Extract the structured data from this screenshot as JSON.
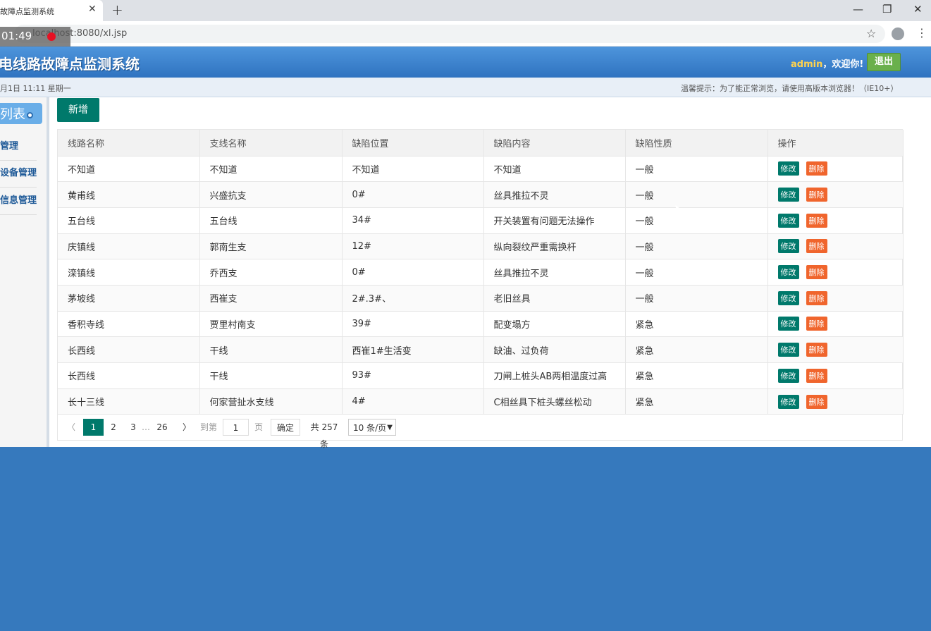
{
  "browser": {
    "tab_title": "故障点监测系统",
    "tab_close": "✕",
    "new_tab": "+",
    "url": "localhost:8080/xl.jsp",
    "url_prefix": "|loc",
    "overlay_time": "01:49",
    "minimize": "—",
    "restore": "❐",
    "close": "✕",
    "star": "☆",
    "menu": "⋮"
  },
  "header": {
    "title": "配电线路故障点监测系统",
    "user": "admin",
    "welcome": "，欢迎你!",
    "logout": "退出"
  },
  "info": {
    "date": "月1日 11:11 星期一",
    "tip": "温馨提示：为了能正常浏览，请使用高版本浏览器！（IE10+）"
  },
  "sidebar": {
    "heading": "列表",
    "items": [
      {
        "label": "管理"
      },
      {
        "label": "设备管理"
      },
      {
        "label": "信息管理"
      }
    ]
  },
  "toolbar": {
    "add_label": "新增"
  },
  "table": {
    "columns": [
      "线路名称",
      "支线名称",
      "缺陷位置",
      "缺陷内容",
      "缺陷性质",
      "操作"
    ],
    "edit_label": "修改",
    "delete_label": "删除",
    "rows": [
      [
        "不知道",
        "不知道",
        "不知道",
        "不知道",
        "一般"
      ],
      [
        "黄甫线",
        "兴盛抗支",
        "0#",
        "丝具推拉不灵",
        "一般"
      ],
      [
        "五台线",
        "五台线",
        "34#",
        "开关装置有问题无法操作",
        "一般"
      ],
      [
        "庆镇线",
        "郭南生支",
        "12#",
        "纵向裂纹严重需换杆",
        "一般"
      ],
      [
        "滦镇线",
        "乔西支",
        "0#",
        "丝具推拉不灵",
        "一般"
      ],
      [
        "茅坡线",
        "西崔支",
        "2#.3#、",
        "老旧丝具",
        "一般"
      ],
      [
        "香积寺线",
        "贾里村南支",
        "39#",
        "配变塌方",
        "紧急"
      ],
      [
        "长西线",
        "干线",
        "西崔1#生活变",
        "缺油、过负荷",
        "紧急"
      ],
      [
        "长西线",
        "干线",
        "93#",
        "刀闸上桩头AB两相温度过高",
        "紧急"
      ],
      [
        "长十三线",
        "何家营扯水支线",
        "4#",
        "C相丝具下桩头螺丝松动",
        "紧急"
      ]
    ]
  },
  "pager": {
    "prev": "〈",
    "pages": [
      "1",
      "2",
      "3"
    ],
    "ellipsis": "…",
    "last": "26",
    "next": "〉",
    "goto_label": "到第",
    "goto_value": "1",
    "page_unit": "页",
    "confirm": "确定",
    "total": "共 257 条",
    "page_size": "10 条/页",
    "caret": "▼"
  }
}
